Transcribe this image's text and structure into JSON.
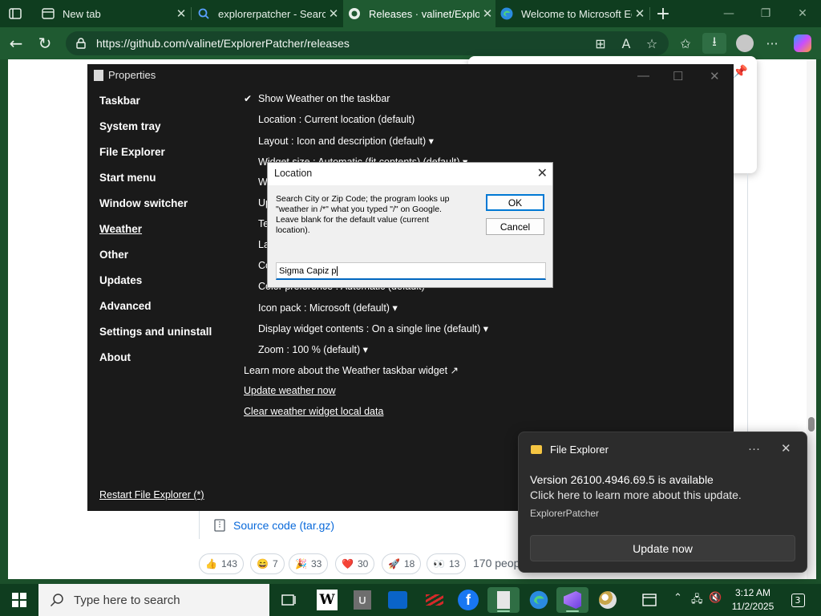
{
  "browser": {
    "tabs": [
      {
        "label": "New tab",
        "icon": "tab-page-icon"
      },
      {
        "label": "explorerpatcher - Search",
        "icon": "search-icon"
      },
      {
        "label": "Releases · valinet/ExplorerPatcher",
        "icon": "github-icon"
      },
      {
        "label": "Welcome to Microsoft Edge",
        "icon": "edge-icon"
      }
    ],
    "new_tab_glyph": "+",
    "url": "https://github.com/valinet/ExplorerPatcher/releases",
    "colors": {
      "frame": "#0f3d1f",
      "toolbar": "#1f5a31"
    }
  },
  "properties": {
    "title": "Properties",
    "nav": [
      "Taskbar",
      "System tray",
      "File Explorer",
      "Start menu",
      "Window switcher",
      "Weather",
      "Other",
      "Updates",
      "Advanced",
      "Settings and uninstall",
      "About"
    ],
    "selected_nav": "Weather",
    "restart_link": "Restart File Explorer (*)",
    "options": {
      "show_weather": "Show Weather on the taskbar",
      "location": "Location : Current location (default)",
      "layout": "Layout : Icon and description (default)",
      "widget_size": "Widget size : Automatic (fit contents) (default)",
      "w_partial": "W",
      "up_partial": "Up",
      "te_partial": "Te",
      "la_partial": "La",
      "co_partial": "Co",
      "color_partial": "Color preference : Automatic (default)",
      "icon_pack": "Icon pack : Microsoft (default)",
      "display_contents": "Display widget contents : On a single line (default)",
      "zoom": "Zoom : 100 % (default)",
      "learn_more": "Learn more about the Weather taskbar widget ↗",
      "update_now": "Update weather now",
      "clear_data": "Clear weather widget local data"
    },
    "checkmark": "✔",
    "dropdown_arrow": "▾"
  },
  "location_dialog": {
    "title": "Location",
    "message": "Search City or Zip Code; the program looks up \"weather in /*\" what you typed \"/\" on Google. Leave blank for the default value (current location).",
    "ok": "OK",
    "cancel": "Cancel",
    "input_value": "Sigma Capiz p"
  },
  "github_page": {
    "source_code": "Source code (tar.gz)",
    "reactions": [
      {
        "emoji": "👍",
        "count": "143"
      },
      {
        "emoji": "😄",
        "count": "7"
      },
      {
        "emoji": "🎉",
        "count": "33"
      },
      {
        "emoji": "❤️",
        "count": "30"
      },
      {
        "emoji": "🚀",
        "count": "18"
      },
      {
        "emoji": "👀",
        "count": "13"
      }
    ],
    "people_text": "170 peop"
  },
  "toast": {
    "app": "File Explorer",
    "more": "···",
    "close": "✕",
    "heading": "Version 26100.4946.69.5 is available",
    "body": "Click here to learn more about this update.",
    "attribution": "ExplorerPatcher",
    "button": "Update now"
  },
  "taskbar": {
    "search_placeholder": "Type here to search",
    "apps": [
      "task-view-icon",
      "wikipedia-icon",
      "notepad-u-icon",
      "outlook-icon",
      "app-red-icon",
      "facebook-icon",
      "properties-icon",
      "edge-icon",
      "visual-studio-icon",
      "paint-icon",
      "window-icon"
    ],
    "wiki_glyph": "W",
    "u_glyph": "U",
    "fb_glyph": "f",
    "time": "3:12 AM",
    "date": "11/2/2025",
    "notifications": "3"
  }
}
